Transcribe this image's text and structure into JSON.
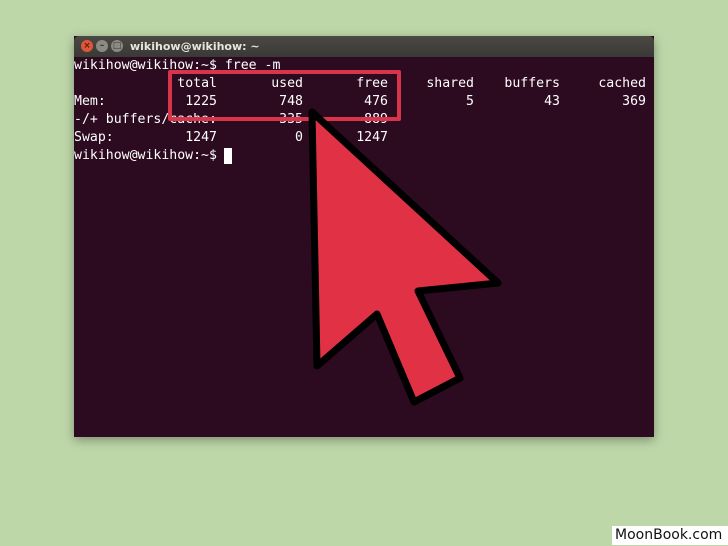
{
  "window": {
    "title": "wikihow@wikihow: ~",
    "close_glyph": "×",
    "minimize_glyph": "–",
    "maximize_glyph": "□"
  },
  "terminal": {
    "prompt": "wikihow@wikihow:~$ ",
    "command": "free -m",
    "header": [
      "total",
      "used",
      "free",
      "shared",
      "buffers",
      "cached"
    ],
    "mem": {
      "label": "Mem:",
      "values": [
        "1225",
        "748",
        "476",
        "5",
        "43",
        "369"
      ]
    },
    "buffers_cache": {
      "label": "-/+ buffers/cache:",
      "values": [
        "",
        "335",
        "889"
      ]
    },
    "swap": {
      "label": "Swap:",
      "values": [
        "1247",
        "0",
        "1247"
      ]
    }
  },
  "colors": {
    "background": "#bed7a9",
    "terminal_bg": "#2c0a1f",
    "highlight": "#d8344a",
    "arrow_fill": "#e03244",
    "arrow_outline": "#000000"
  },
  "watermark": "MoonBook.com"
}
